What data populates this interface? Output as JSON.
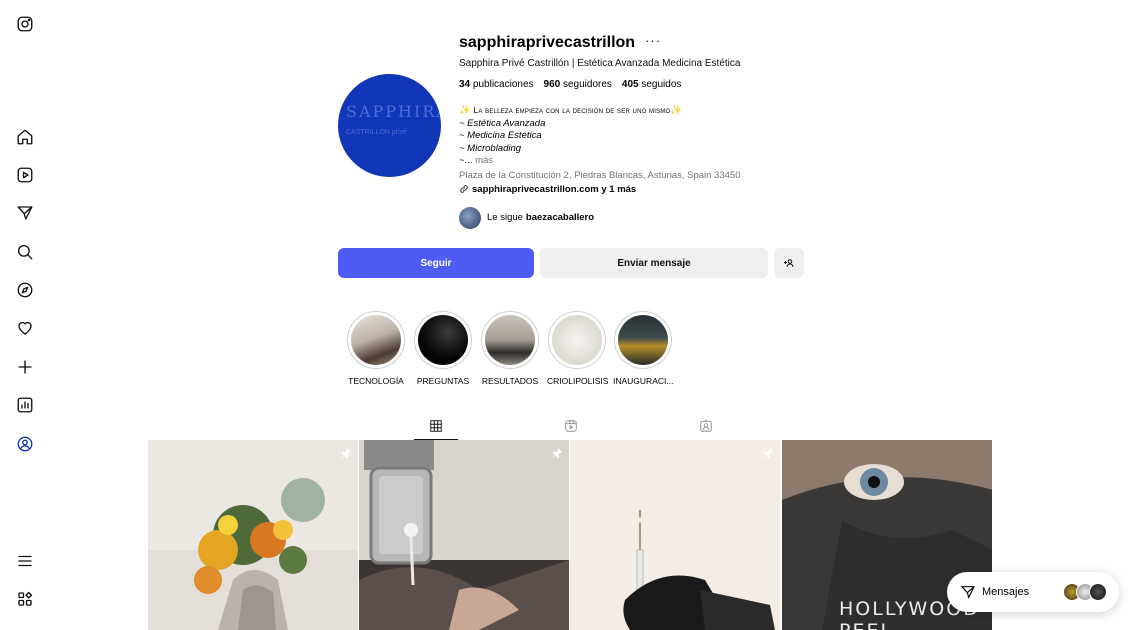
{
  "profile": {
    "username": "sapphiraprivecastrillon",
    "more": "···",
    "full_name": "Sapphira Privé Castrillón | Estética Avanzada Medicina Estética",
    "stats": {
      "posts_count": "34",
      "posts_label": "publicaciones",
      "followers_count": "960",
      "followers_label": "seguidores",
      "following_count": "405",
      "following_label": "seguidos"
    },
    "avatar_text": "SAPPHIRA",
    "avatar_sub": "CASTRILLÓN  privé",
    "bio_line1": "La belleza empieza con la decisión de ser uno mismo",
    "bio_line2": "~ Estética Avanzada",
    "bio_line3": "~ Medicina Estética",
    "bio_line4": "~ Microblading",
    "bio_line5": "~...",
    "bio_more": "más",
    "address": "Plaza de la Constitución 2, Piedras Blancas, Asturias, Spain 33450",
    "link": "sapphiraprivecastrillon.com y 1 más",
    "followed_by_prefix": "Le sigue",
    "followed_by_user": "baezacaballero"
  },
  "actions": {
    "follow_label": "Seguir",
    "message_label": "Enviar mensaje",
    "add_user_icon": "person-add-icon"
  },
  "highlights": [
    {
      "label": "TECNOLOGÍA"
    },
    {
      "label": "PREGUNTAS"
    },
    {
      "label": "RESULTADOS"
    },
    {
      "label": "CRIOLIPOLISIS"
    },
    {
      "label": "INAUGURACI..."
    }
  ],
  "tabs": [
    {
      "icon": "grid-icon",
      "active": true
    },
    {
      "icon": "reels-icon",
      "active": false
    },
    {
      "icon": "tagged-icon",
      "active": false
    }
  ],
  "posts": [
    {
      "pinned": true,
      "overlay_text": ""
    },
    {
      "pinned": true,
      "overlay_text": ""
    },
    {
      "pinned": true,
      "overlay_text": ""
    },
    {
      "pinned": false,
      "overlay_text": "HOLLYWOOD PEEL"
    }
  ],
  "messages": {
    "label": "Mensajes"
  },
  "colors": {
    "accent": "#4f5bf5",
    "avatar_bg": "#1136b8"
  }
}
